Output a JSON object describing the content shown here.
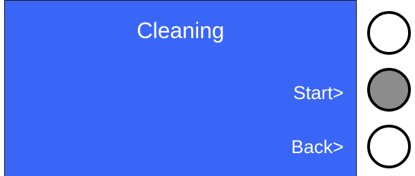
{
  "screen": {
    "title": "Cleaning",
    "background_color": "#3a66f8",
    "text_color": "#ffffff",
    "soft_labels": {
      "start": "Start>",
      "back": "Back>"
    }
  },
  "side_buttons": [
    {
      "name": "top",
      "state": "idle",
      "fill": "#ffffff"
    },
    {
      "name": "start",
      "state": "pressed",
      "fill": "#8c8c8c"
    },
    {
      "name": "back",
      "state": "idle",
      "fill": "#ffffff"
    }
  ]
}
